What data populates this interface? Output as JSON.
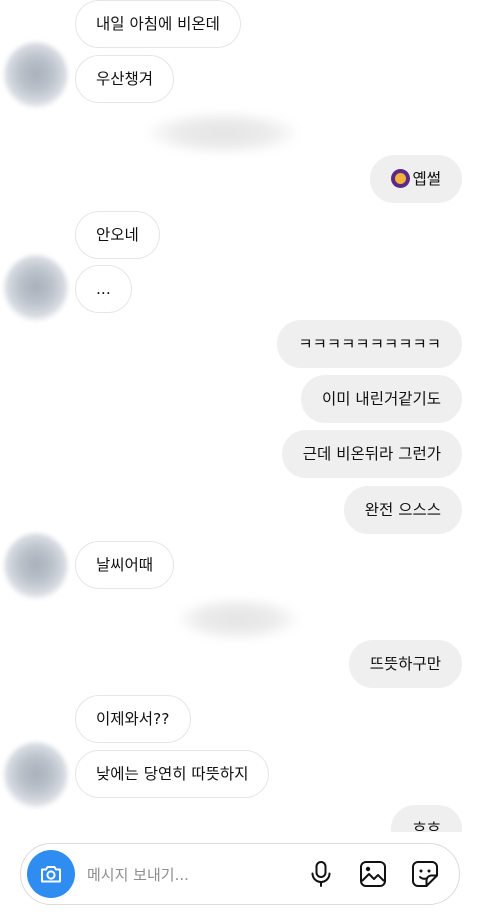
{
  "messages": [
    {
      "side": "in",
      "text": "내일 아침에 비온데"
    },
    {
      "side": "in",
      "text": "우산챙겨"
    },
    {
      "side": "out",
      "text": "옙썰"
    },
    {
      "side": "in",
      "text": "안오네"
    },
    {
      "side": "in",
      "text": "..."
    },
    {
      "side": "out",
      "text": "ㅋㅋㅋㅋㅋㅋㅋㅋㅋㅋ"
    },
    {
      "side": "out",
      "text": "이미 내린거같기도"
    },
    {
      "side": "out",
      "text": "근데 비온뒤라 그런가"
    },
    {
      "side": "out",
      "text": "완전 으스스"
    },
    {
      "side": "in",
      "text": "날씨어때"
    },
    {
      "side": "out",
      "text": "뜨뜻하구만"
    },
    {
      "side": "in",
      "text": "이제와서??"
    },
    {
      "side": "in",
      "text": "낮에는 당연히 따뜻하지"
    },
    {
      "side": "out",
      "text": "흐흐"
    }
  ],
  "composer": {
    "placeholder": "메시지 보내기..."
  },
  "icons": {
    "camera": "camera-icon",
    "microphone": "microphone-icon",
    "gallery": "image-icon",
    "sticker": "sticker-icon"
  },
  "colors": {
    "camera_button": "#2f8cf0",
    "outgoing_bubble": "#efefef",
    "incoming_border": "#e6e6e6"
  }
}
